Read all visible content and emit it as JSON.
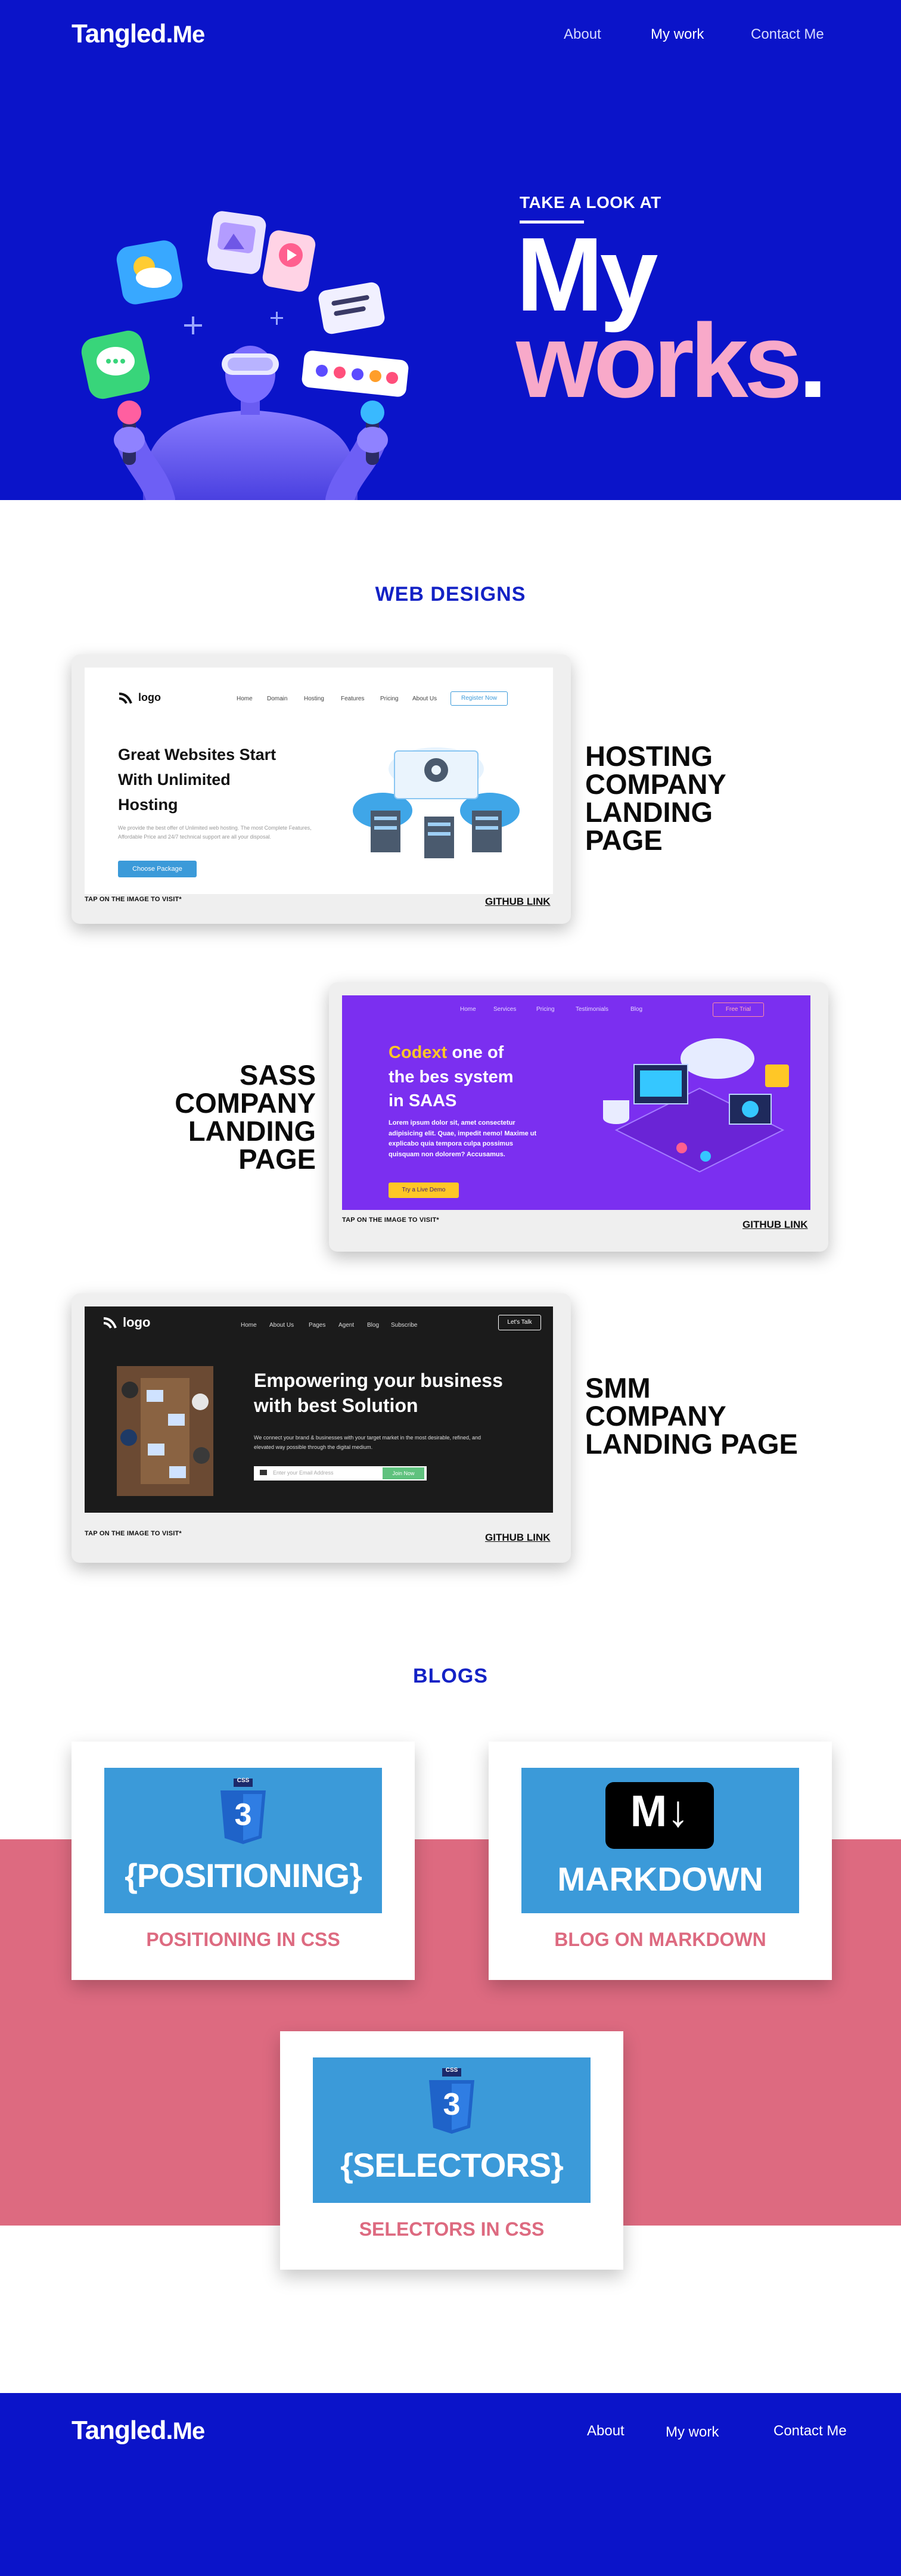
{
  "nav": {
    "brand": "Tangled.",
    "brand_suffix": "Me",
    "links": [
      "About",
      "My work",
      "Contact Me"
    ]
  },
  "hero": {
    "eyebrow": "TAKE A LOOK AT",
    "title_line1": "My",
    "title_line2": "works",
    "title_dot": "."
  },
  "web_designs": {
    "heading": "WEB DESIGNS",
    "tap_text": "TAP ON THE IMAGE TO VISIT*",
    "github_text": "GITHUB LINK",
    "projects": [
      {
        "title": [
          "HOSTING",
          "COMPANY",
          "LANDING",
          "PAGE"
        ],
        "mock": {
          "logo": "logo",
          "nav": [
            "Home",
            "Domain",
            "Hosting",
            "Features",
            "Pricing",
            "About Us"
          ],
          "cta": "Register Now",
          "headline": [
            "Great Websites Start",
            "With Unlimited",
            "Hosting"
          ],
          "body": "We provide the best offer of Unlimited web hosting. The most Complete Features, Affordable Price and 24/7 technical support are all your disposal.",
          "button": "Choose Package"
        }
      },
      {
        "title": [
          "SASS",
          "COMPANY",
          "LANDING",
          "PAGE"
        ],
        "mock": {
          "nav": [
            "Home",
            "Services",
            "Pricing",
            "Testimonials",
            "Blog"
          ],
          "cta": "Free Trial",
          "headline_accent": "Codext",
          "headline_rest": " one of",
          "headline_lines": [
            "the bes system",
            "in SAAS"
          ],
          "body": "Lorem ipsum dolor sit, amet consectetur adipisicing elit. Quae, impedit nemo! Maxime ut explicabo quia tempora culpa possimus quisquam non dolorem? Accusamus.",
          "button": "Try a Live Demo"
        }
      },
      {
        "title": [
          "SMM",
          "COMPANY",
          "LANDING PAGE"
        ],
        "mock": {
          "logo": "logo",
          "nav": [
            "Home",
            "About Us",
            "Pages",
            "Agent",
            "Blog",
            "Subscribe"
          ],
          "cta": "Let's Talk",
          "headline": [
            "Empowering your business",
            "with best Solution"
          ],
          "body": "We connect your brand & businesses with your target market in the most desirable, refined, and elevated way possible through the digital medium.",
          "input_placeholder": "Enter your Email Address",
          "button": "Join Now"
        }
      }
    ]
  },
  "blogs": {
    "heading": "BLOGS",
    "items": [
      {
        "label": "POSITIONING IN CSS",
        "image_text": "{POSITIONING}",
        "badge": "CSS",
        "icon": "css3-icon"
      },
      {
        "label": "BLOG ON MARKDOWN",
        "image_text": "MARKDOWN",
        "badge": "M↓",
        "icon": "markdown-icon"
      },
      {
        "label": "SELECTORS IN CSS",
        "image_text": "{SELECTORS}",
        "badge": "CSS",
        "icon": "css3-icon"
      }
    ]
  },
  "footer": {
    "brand": "Tangled.",
    "brand_suffix": "Me",
    "links": [
      "About",
      "My work",
      "Contact Me"
    ]
  },
  "colors": {
    "brand_blue": "#0b14c9",
    "heading_blue": "#1322c5",
    "pink": "#f8a9c9",
    "blog_pink": "#dd6a80",
    "blog_image_blue": "#3b9ad9",
    "sass_purple": "#7b2ff0"
  }
}
